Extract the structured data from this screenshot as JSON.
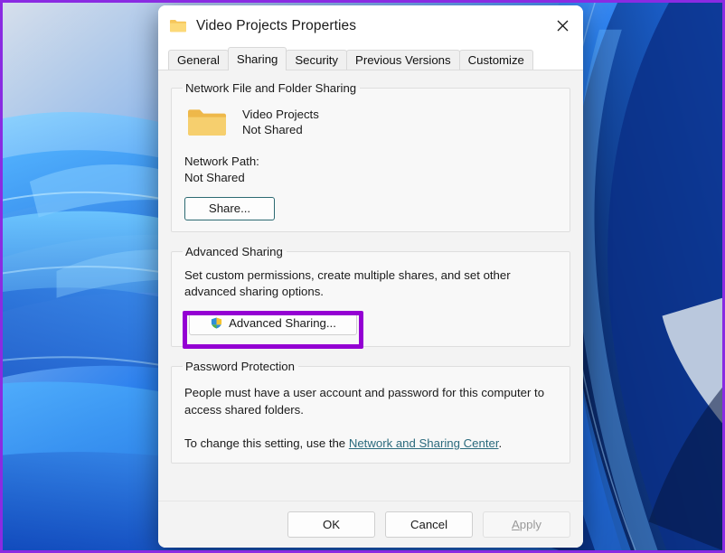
{
  "window": {
    "title": "Video Projects Properties",
    "icon": "folder-icon",
    "close_label": "close-icon"
  },
  "tabs": [
    {
      "label": "General",
      "active": false
    },
    {
      "label": "Sharing",
      "active": true
    },
    {
      "label": "Security",
      "active": false
    },
    {
      "label": "Previous Versions",
      "active": false
    },
    {
      "label": "Customize",
      "active": false
    }
  ],
  "network_sharing": {
    "legend": "Network File and Folder Sharing",
    "folder_name": "Video Projects",
    "folder_status": "Not Shared",
    "network_path_label": "Network Path:",
    "network_path_value": "Not Shared",
    "share_button": "Share..."
  },
  "advanced_sharing": {
    "legend": "Advanced Sharing",
    "description": "Set custom permissions, create multiple shares, and set other advanced sharing options.",
    "button_label": "Advanced Sharing...",
    "button_icon": "uac-shield-icon",
    "highlight_color": "#9400d3"
  },
  "password_protection": {
    "legend": "Password Protection",
    "paragraph_1": "People must have a user account and password for this computer to access shared folders.",
    "paragraph_2_prefix": "To change this setting, use the ",
    "link_text": "Network and Sharing Center",
    "paragraph_2_suffix": ".",
    "link_color": "#2b6a7d"
  },
  "footer": {
    "ok": "OK",
    "cancel": "Cancel",
    "apply_prefix": "A",
    "apply_rest": "pply",
    "apply_disabled": true
  },
  "annotation": {
    "frame_color": "#8a2be2"
  }
}
